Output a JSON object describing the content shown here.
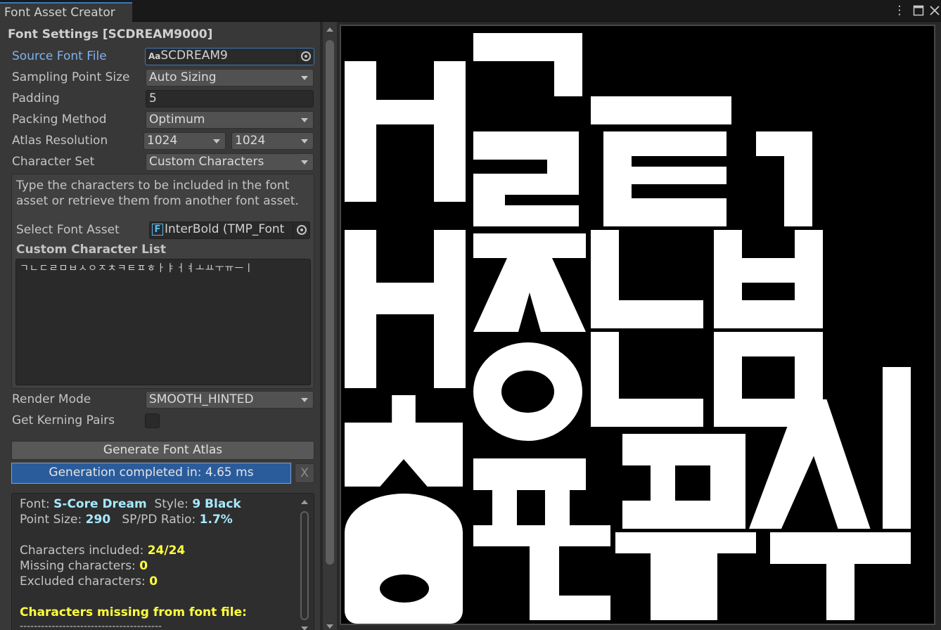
{
  "window": {
    "tab_title": "Font Asset Creator",
    "menu_icon": "kebab-menu-icon",
    "maximize_icon": "maximize-icon",
    "close_icon": "close-icon"
  },
  "settings": {
    "section_title": "Font Settings [SCDREAM9000]",
    "source_font_label": "Source Font File",
    "source_font_value": "SCDREAM9",
    "source_font_icon_text": "Aa",
    "sampling_label": "Sampling Point Size",
    "sampling_value": "Auto Sizing",
    "padding_label": "Padding",
    "padding_value": "5",
    "packing_label": "Packing Method",
    "packing_value": "Optimum",
    "atlas_label": "Atlas Resolution",
    "atlas_width": "1024",
    "atlas_height": "1024",
    "charset_label": "Character Set",
    "charset_value": "Custom Characters",
    "help_text": "Type the characters to be included in the font asset or retrieve them from another font asset.",
    "select_font_label": "Select Font Asset",
    "select_font_value": "InterBold (TMP_Font",
    "select_font_icon_text": "F",
    "custom_list_label": "Custom Character List",
    "custom_list_value": "ㄱㄴㄷㄹㅁㅂㅅㅇㅈㅊㅋㅌㅍㅎㅏㅑㅓㅕㅗㅛㅜㅠㅡㅣ",
    "render_mode_label": "Render Mode",
    "render_mode_value": "SMOOTH_HINTED",
    "kerning_label": "Get Kerning Pairs",
    "kerning_checked": false,
    "generate_button": "Generate Font Atlas",
    "progress_text": "Generation completed in: 4.65 ms",
    "progress_fraction": 1.0,
    "cancel_button": "X"
  },
  "info": {
    "font_label": "Font:",
    "font_value": "S-Core Dream",
    "style_label": "Style:",
    "style_value": "9 Black",
    "point_size_label": "Point Size:",
    "point_size_value": "290",
    "ratio_label": "SP/PD Ratio:",
    "ratio_value": "1.7%",
    "included_label": "Characters included:",
    "included_value": "24/24",
    "missing_label": "Missing characters:",
    "missing_value": "0",
    "excluded_label": "Excluded characters:",
    "excluded_value": "0",
    "missing_heading": "Characters missing from font file:",
    "separator": "----------------------------------------"
  },
  "colors": {
    "accent": "#3a79bb",
    "label_active": "#7fb2ed",
    "value_cyan": "#a6e9ff",
    "value_yellow": "#ffff40",
    "progress_fill": "#2a5c9c"
  }
}
